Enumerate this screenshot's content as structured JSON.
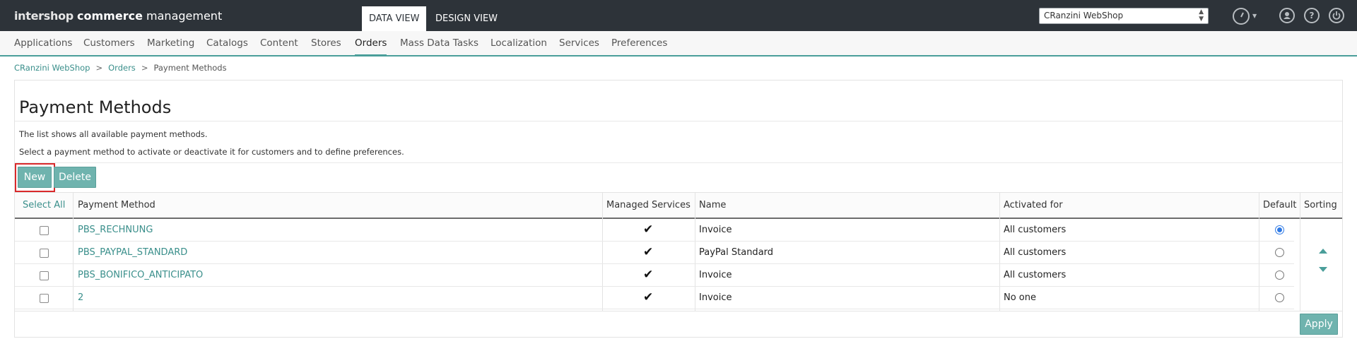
{
  "header": {
    "logo_brand": "intershop",
    "logo_word1": "commerce",
    "logo_word2": "management",
    "view_tabs": [
      "DATA VIEW",
      "DESIGN VIEW"
    ],
    "site_select_value": "CRanzini WebShop"
  },
  "nav": {
    "items": [
      "Applications",
      "Customers",
      "Marketing",
      "Catalogs",
      "Content",
      "Stores",
      "Orders",
      "Mass Data Tasks",
      "Localization",
      "Services",
      "Preferences"
    ],
    "active": "Orders"
  },
  "breadcrumb": {
    "items": [
      "CRanzini WebShop",
      "Orders",
      "Payment Methods"
    ],
    "separator": ">"
  },
  "page": {
    "title": "Payment Methods",
    "description1": "The list shows all available payment methods.",
    "description2": "Select a payment method to activate or deactivate it for customers and to define preferences."
  },
  "buttons": {
    "new_label": "New",
    "delete_label": "Delete",
    "apply_label": "Apply"
  },
  "table": {
    "columns": {
      "select_all": "Select All",
      "payment_method": "Payment Method",
      "managed_services": "Managed Services",
      "name": "Name",
      "activated_for": "Activated for",
      "default": "Default",
      "sorting": "Sorting"
    },
    "check_glyph": "✔",
    "rows": [
      {
        "payment_method": "PBS_RECHNUNG",
        "name": "Invoice",
        "activated_for": "All customers",
        "managed": true,
        "default": true
      },
      {
        "payment_method": "PBS_PAYPAL_STANDARD",
        "name": "PayPal Standard",
        "activated_for": "All customers",
        "managed": true,
        "default": false
      },
      {
        "payment_method": "PBS_BONIFICO_ANTICIPATO",
        "name": "Invoice",
        "activated_for": "All customers",
        "managed": true,
        "default": false
      },
      {
        "payment_method": "2",
        "name": "Invoice",
        "activated_for": "No one",
        "managed": true,
        "default": false
      }
    ]
  },
  "colors": {
    "accent": "#4a9e9a",
    "topbar": "#2d3339",
    "button": "#6fb3ae",
    "highlight": "#d9292b",
    "radio_selected": "#2f7ae5"
  }
}
